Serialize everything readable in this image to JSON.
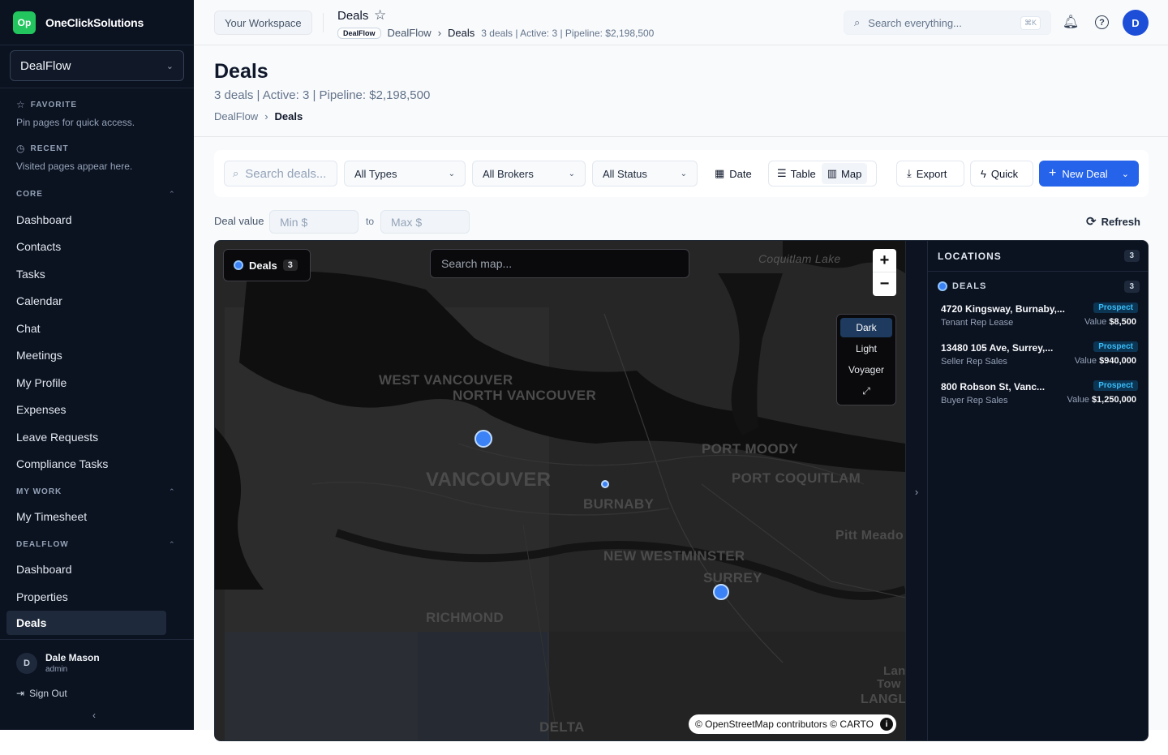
{
  "app": {
    "brand": "OneClickSolutions",
    "logo": "Op",
    "workspace_select": "DealFlow"
  },
  "sidebar": {
    "favorite": {
      "caption": "FAVORITE",
      "hint": "Pin pages for quick access."
    },
    "recent": {
      "caption": "RECENT",
      "hint": "Visited pages appear here."
    },
    "core": {
      "caption": "CORE",
      "items": [
        "Dashboard",
        "Contacts",
        "Tasks",
        "Calendar",
        "Chat",
        "Meetings",
        "My Profile",
        "Expenses",
        "Leave Requests",
        "Compliance Tasks"
      ]
    },
    "my_work": {
      "caption": "MY WORK",
      "items": [
        "My Timesheet"
      ]
    },
    "dealflow": {
      "caption": "DEALFLOW",
      "items": [
        "Dashboard",
        "Properties",
        "Deals"
      ]
    },
    "user": {
      "initial": "D",
      "name": "Dale Mason",
      "role": "admin",
      "sign_out": "Sign Out"
    }
  },
  "topbar": {
    "workspace_button": "Your Workspace",
    "title": "Deals",
    "pill": "DealFlow",
    "crumb_parent": "DealFlow",
    "crumb_current": "Deals",
    "meta": "3 deals | Active: 3 | Pipeline: $2,198,500",
    "search_placeholder": "Search everything...",
    "shortcut": "⌘K",
    "avatar": "D"
  },
  "page": {
    "title": "Deals",
    "subtitle": "3 deals | Active: 3 | Pipeline: $2,198,500",
    "crumb_parent": "DealFlow",
    "crumb_current": "Deals"
  },
  "filters": {
    "search_placeholder": "Search deals...",
    "types": "All Types",
    "brokers": "All Brokers",
    "status": "All Status",
    "date": "Date",
    "view_table": "Table",
    "view_map": "Map",
    "export": "Export",
    "quick": "Quick",
    "new_deal": "New Deal",
    "deal_value_label": "Deal value",
    "min_placeholder": "Min $",
    "to": "to",
    "max_placeholder": "Max $",
    "refresh": "Refresh"
  },
  "map": {
    "layer_label": "Deals",
    "layer_count": "3",
    "search_placeholder": "Search map...",
    "zoom_in": "+",
    "zoom_out": "−",
    "styles": [
      "Dark",
      "Light",
      "Voyager"
    ],
    "selected_style": "Dark",
    "attribution": "© OpenStreetMap contributors © CARTO",
    "place_labels": [
      "Coquitlam Lake",
      "WEST VANCOUVER",
      "NORTH VANCOUVER",
      "VANCOUVER",
      "BURNABY",
      "PORT MOODY",
      "PORT COQUITLAM",
      "Pitt Meado",
      "NEW WESTMINSTER",
      "SURREY",
      "RICHMOND",
      "DELTA",
      "Lan",
      "Tow",
      "LANGL"
    ]
  },
  "locations": {
    "title": "LOCATIONS",
    "count": "3",
    "group": "DEALS",
    "group_count": "3",
    "deals": [
      {
        "address": "4720 Kingsway, Burnaby,...",
        "type": "Tenant Rep Lease",
        "status": "Prospect",
        "value_label": "Value",
        "value": "$8,500"
      },
      {
        "address": "13480 105 Ave, Surrey,...",
        "type": "Seller Rep Sales",
        "status": "Prospect",
        "value_label": "Value",
        "value": "$940,000"
      },
      {
        "address": "800 Robson St, Vanc...",
        "type": "Buyer Rep Sales",
        "status": "Prospect",
        "value_label": "Value",
        "value": "$1,250,000"
      }
    ]
  },
  "colors": {
    "accent": "#2563eb",
    "sidebar_bg": "#0b1220",
    "logo": "#22c55e",
    "map_bg": "#262626",
    "prospect": "#38bdf8"
  },
  "icons": [
    "star-icon",
    "search-icon",
    "bell-icon",
    "help-icon",
    "chevron-down-icon",
    "calendar-icon",
    "list-icon",
    "map-icon",
    "download-icon",
    "bolt-icon",
    "plus-icon",
    "refresh-icon",
    "info-icon",
    "expand-icon",
    "chevron-right-icon",
    "sign-out-icon",
    "chevron-left-icon"
  ]
}
